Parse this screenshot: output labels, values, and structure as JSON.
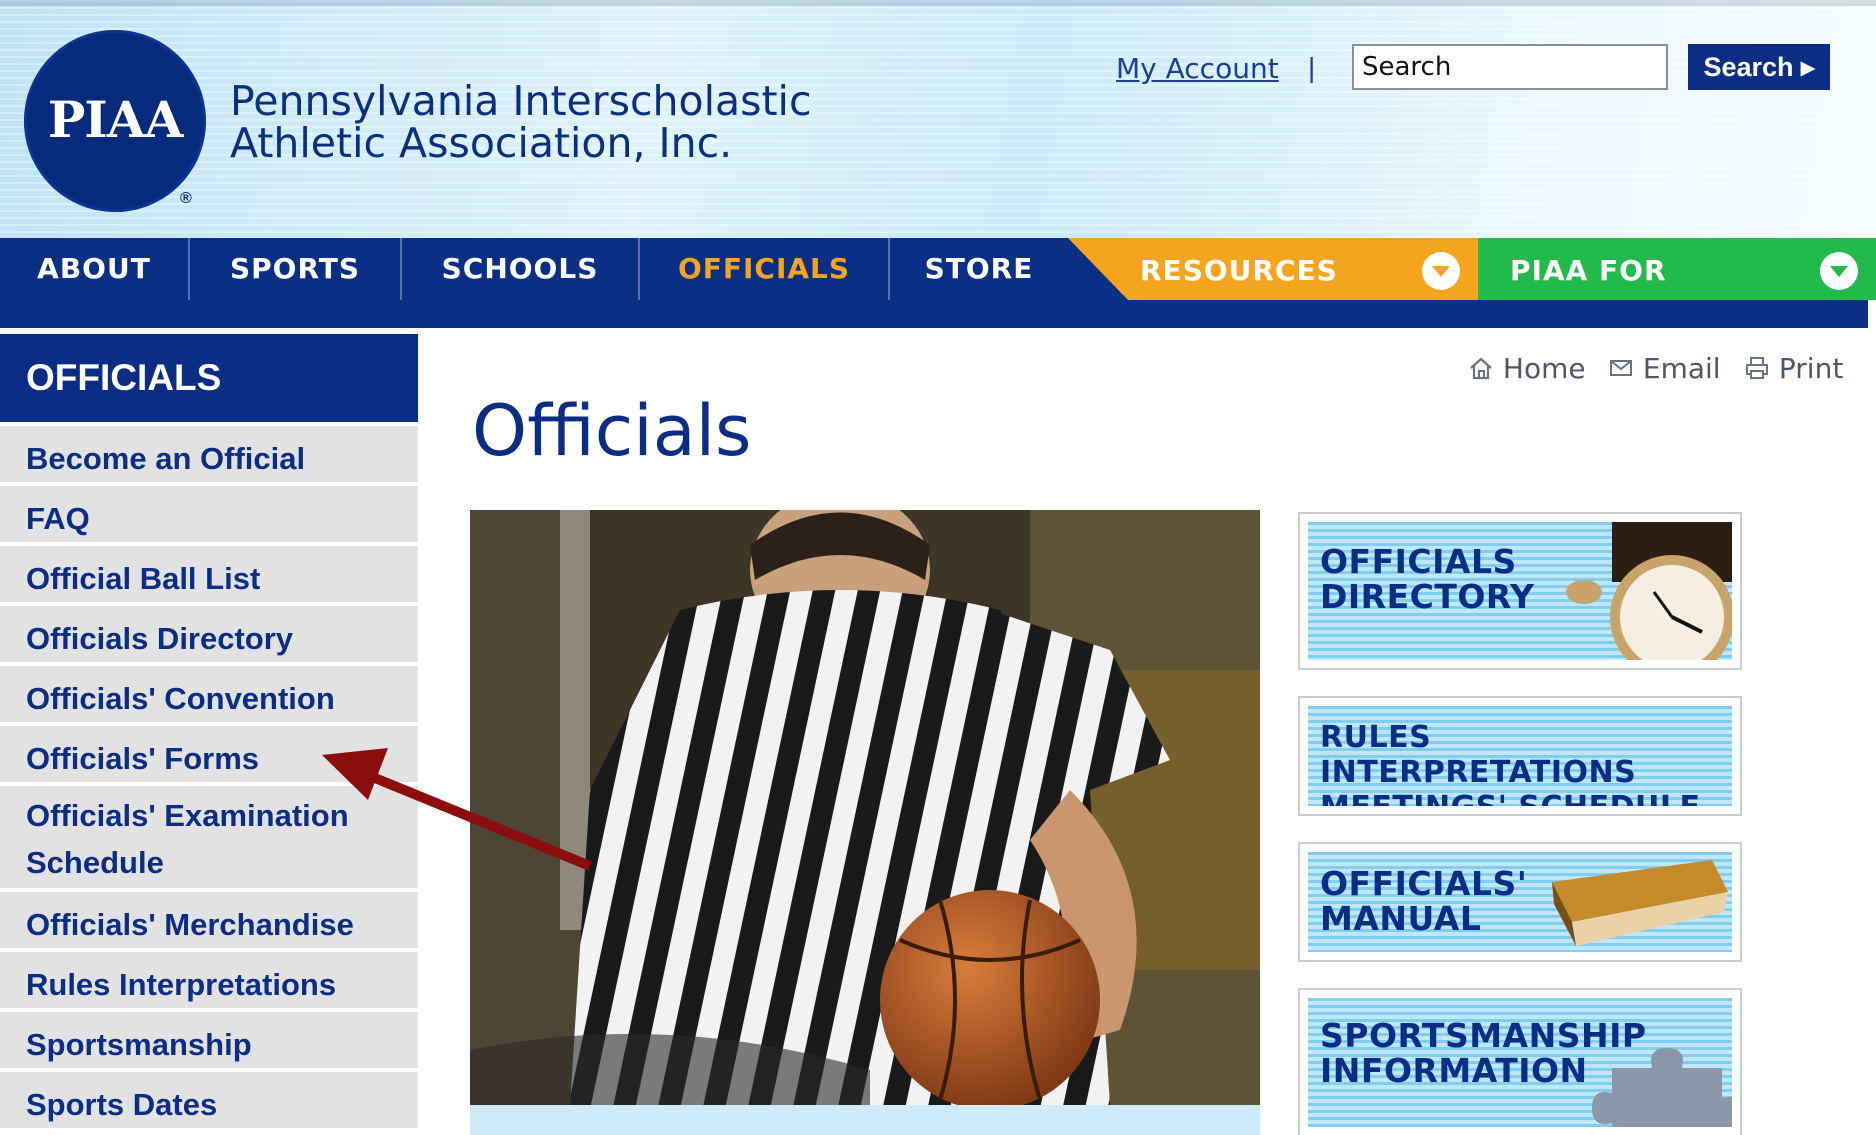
{
  "header": {
    "logo_text": "PIAA",
    "logo_reg": "®",
    "org_name_line1": "Pennsylvania Interscholastic",
    "org_name_line2": "Athletic Association, Inc.",
    "my_account": "My Account",
    "separator": "|",
    "search_value": "Search",
    "search_button": "Search ▸"
  },
  "nav": {
    "items": [
      "ABOUT",
      "SPORTS",
      "SCHOOLS",
      "OFFICIALS",
      "STORE"
    ],
    "active": "OFFICIALS",
    "active_color": "#f5a51d",
    "resources": "RESOURCES",
    "piaa_for": "PIAA FOR",
    "resources_color": "#f5a51d",
    "piaa_for_color": "#21bb4b"
  },
  "sidebar": {
    "heading": "OFFICIALS",
    "items": [
      "Become an Official",
      "FAQ",
      "Official Ball List",
      "Officials Directory",
      "Officials' Convention",
      "Officials' Forms",
      "Officials' Examination Schedule",
      "Officials' Merchandise",
      "Rules Interpretations",
      "Sportsmanship",
      "Sports Dates"
    ]
  },
  "tools": {
    "home": "Home",
    "email": "Email",
    "print": "Print"
  },
  "main": {
    "title": "Officials"
  },
  "promos": [
    {
      "line1": "OFFICIALS",
      "line2": "DIRECTORY",
      "icon": "stopwatch-icon"
    },
    {
      "line1": "RULES INTERPRETATIONS",
      "line2": "MEETINGS' SCHEDULE",
      "icon": ""
    },
    {
      "line1": "OFFICIALS'",
      "line2": "MANUAL",
      "icon": "book-icon"
    },
    {
      "line1": "SPORTSMANSHIP",
      "line2": "INFORMATION",
      "icon": "puzzle-piece-icon"
    }
  ],
  "colors": {
    "brand_blue": "#0b2d83",
    "annotation_arrow": "#8b0d0d"
  }
}
